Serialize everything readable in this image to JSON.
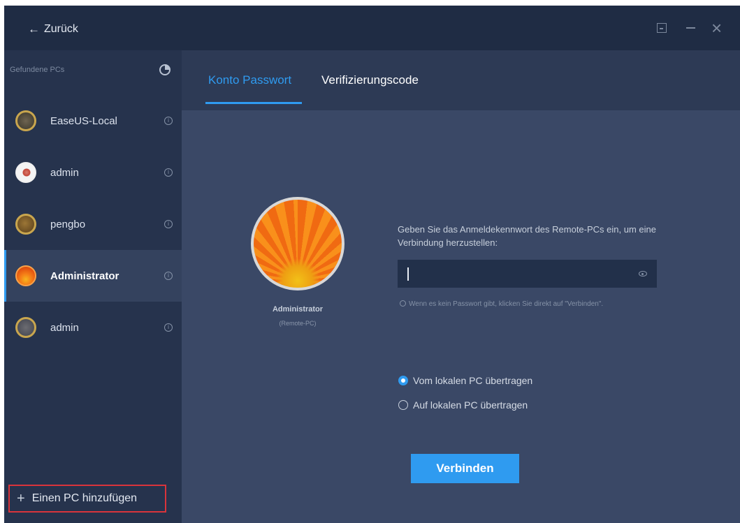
{
  "header": {
    "back_label": "Zurück"
  },
  "sidebar": {
    "title": "Gefundene PCs",
    "items": [
      {
        "name": "EaseUS-Local",
        "avatar": "gold-ring-avatar"
      },
      {
        "name": "admin",
        "avatar": "white-flower-avatar"
      },
      {
        "name": "pengbo",
        "avatar": "brown-avatar"
      },
      {
        "name": "Administrator",
        "avatar": "orange-flower-avatar",
        "selected": true
      },
      {
        "name": "admin",
        "avatar": "gray-avatar"
      }
    ],
    "add_pc_label": "Einen PC hinzufügen"
  },
  "tabs": [
    {
      "label": "Konto Passwort",
      "active": true
    },
    {
      "label": "Verifizierungscode",
      "active": false
    }
  ],
  "remote_user": {
    "name": "Administrator",
    "subtitle": "(Remote-PC)"
  },
  "form": {
    "prompt": "Geben Sie das Anmeldekennwort des Remote-PCs ein, um eine Verbindung herzustellen:",
    "password_value": "",
    "hint": "Wenn es kein Passwort gibt, klicken Sie direkt auf \"Verbinden\".",
    "options": [
      {
        "label": "Vom lokalen PC übertragen",
        "checked": true
      },
      {
        "label": "Auf lokalen PC übertragen",
        "checked": false
      }
    ],
    "connect_label": "Verbinden"
  },
  "colors": {
    "accent": "#2f9bf0",
    "sidebar_bg": "#26334d",
    "content_bg": "#3a4866",
    "highlight_border": "#d9343b"
  }
}
